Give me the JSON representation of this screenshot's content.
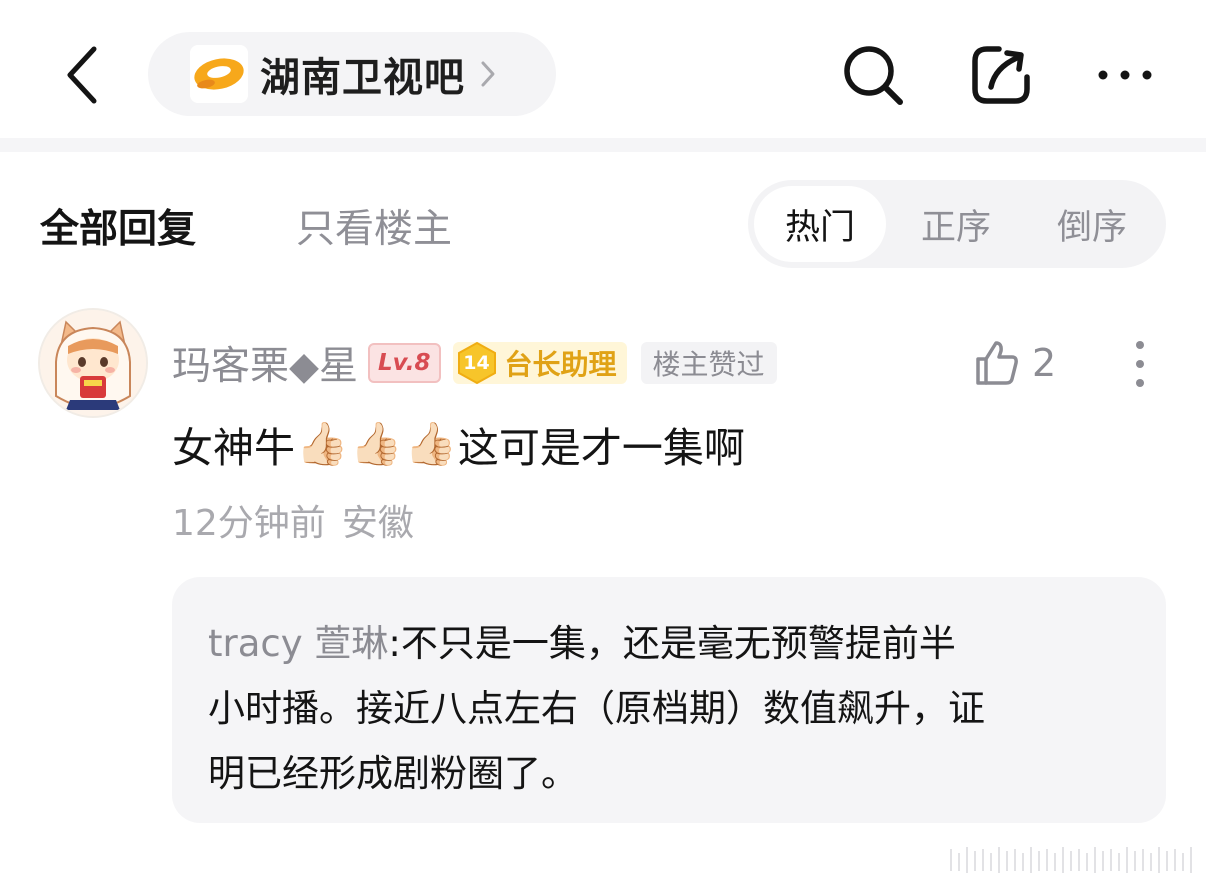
{
  "header": {
    "back_icon": "chevron-left-icon",
    "forum": {
      "name": "湖南卫视吧",
      "logo_icon": "hunan-tv-logo-icon",
      "chevron_icon": "chevron-right-icon"
    },
    "search_icon": "search-icon",
    "share_icon": "share-icon",
    "more_icon": "more-horizontal-icon"
  },
  "filters": {
    "all_replies": "全部回复",
    "op_only": "只看楼主",
    "sort": {
      "hot": "热门",
      "asc": "正序",
      "desc": "倒序",
      "selected": "热门"
    }
  },
  "comment": {
    "username": "玛客栗◆星",
    "level_badge": "Lv.8",
    "role_level": "14",
    "role_name": "台长助理",
    "liked_by_op": "楼主赞过",
    "like_count": "2",
    "text_before": "女神牛",
    "emojis": [
      "👍🏻",
      "👍🏻",
      "👍🏻"
    ],
    "text_after": "这可是才一集啊",
    "time": "12分钟前",
    "location": "安徽",
    "reply": {
      "user": "tracy 萱琳",
      "separator": ":",
      "text_lines": [
        "不只是一集，还是毫无预警提前半",
        "小时播。接近八点左右（原档期）数值飙升，证",
        "明已经形成剧粉圈了。"
      ]
    }
  },
  "colors": {
    "text_primary": "#141414",
    "text_secondary": "#8c8c93",
    "pill_bg": "#f4f4f6",
    "level_red": "#d84c52",
    "role_gold": "#e0a216",
    "logo_orange": "#f5a623"
  }
}
